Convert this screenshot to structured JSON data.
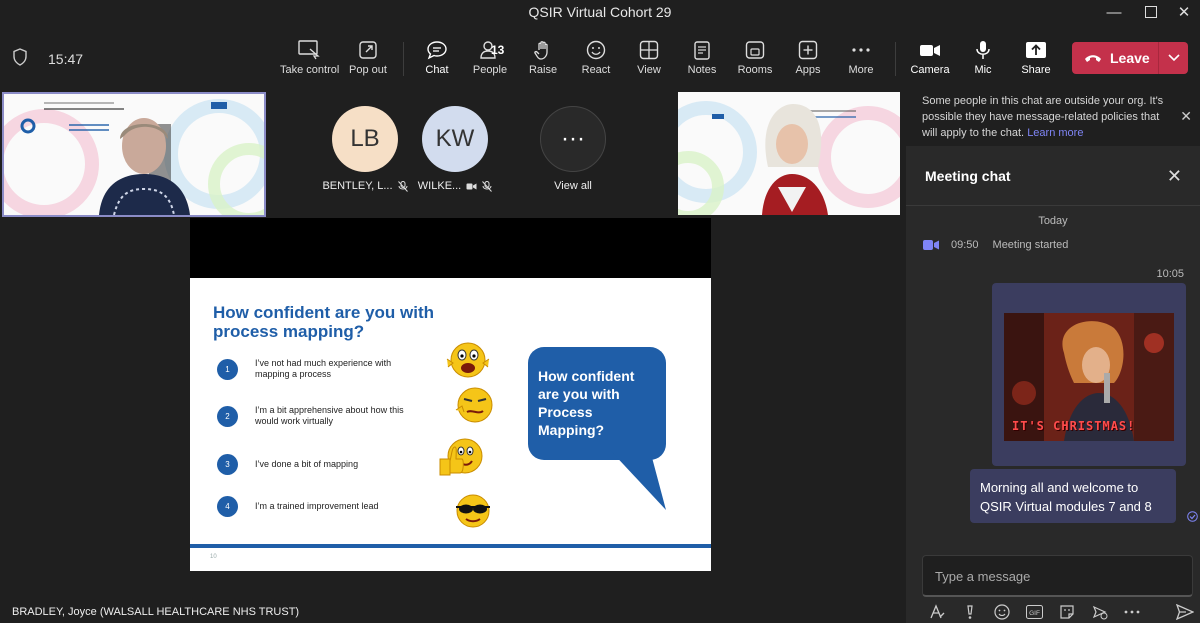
{
  "window": {
    "title": "QSIR Virtual Cohort 29"
  },
  "toolbar": {
    "time": "15:47",
    "take_control": "Take control",
    "pop_out": "Pop out",
    "chat": "Chat",
    "people": "People",
    "people_count": "13",
    "raise": "Raise",
    "react": "React",
    "view": "View",
    "notes": "Notes",
    "rooms": "Rooms",
    "apps": "Apps",
    "more": "More",
    "camera": "Camera",
    "mic": "Mic",
    "share": "Share",
    "leave": "Leave"
  },
  "participants": [
    {
      "initials": "LB",
      "name": "BENTLEY, L...",
      "color": "#f6dfc6"
    },
    {
      "initials": "KW",
      "name": "WILKE...",
      "color": "#d2dcee"
    },
    {
      "initials": "···",
      "name": "View all",
      "color": "#292929"
    }
  ],
  "slide": {
    "title": "How confident are you with process mapping?",
    "options": [
      {
        "num": "1",
        "text": "I’ve not had much experience with mapping a process"
      },
      {
        "num": "2",
        "text": "I’m a bit apprehensive about how this would work virtually"
      },
      {
        "num": "3",
        "text": "I’ve done a bit of  mapping"
      },
      {
        "num": "4",
        "text": "I’m a trained improvement lead"
      }
    ],
    "bubble": "How confident are you with Process Mapping?",
    "page_number": "10"
  },
  "presenter": "BRADLEY, Joyce (WALSALL HEALTHCARE NHS TRUST)",
  "chat": {
    "notice": "Some people in this chat are outside your org. It's possible they have message-related policies that will apply to the chat.",
    "learn_more": "Learn more",
    "title": "Meeting chat",
    "day": "Today",
    "event_time": "09:50",
    "event_text": "Meeting started",
    "msg_time": "10:05",
    "gif_caption": "IT'S CHRISTMAS!",
    "message": "Morning all and welcome to QSIR Virtual modules 7 and 8",
    "compose_placeholder": "Type a message"
  },
  "colors": {
    "accent": "#7f85f5",
    "leave": "#c4314b",
    "slide_blue": "#1f5ea8",
    "bubble_bg": "#3b3d5f"
  }
}
